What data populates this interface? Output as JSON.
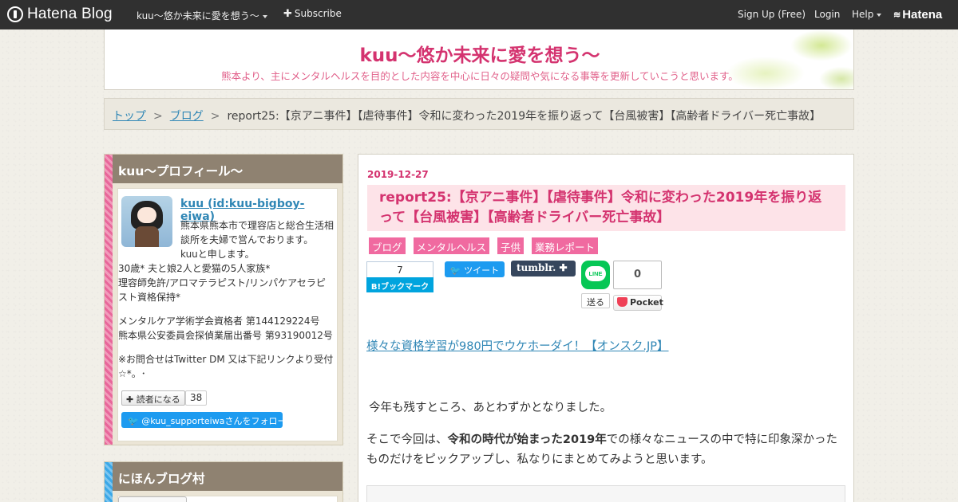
{
  "topbar": {
    "logo_text": "Hatena Blog",
    "blog_name": "kuu～悠か未来に愛を想う～",
    "subscribe_label": "Subscribe",
    "signup_label": "Sign Up (Free)",
    "login_label": "Login",
    "help_label": "Help",
    "hatena_label": "Hatena"
  },
  "header": {
    "title": "kuu～悠か未来に愛を想う～",
    "description": "熊本より、主にメンタルヘルスを目的とした内容を中心に日々の疑問や気になる事等を更新していこうと思います。"
  },
  "breadcrumb": {
    "items": [
      "トップ",
      "ブログ"
    ],
    "separator": ">",
    "current": "report25:【京アニ事件】【虐待事件】令和に変わった2019年を振り返って【台風被害】【高齢者ドライバー死亡事故】"
  },
  "sidebar": {
    "profile": {
      "title": "kuu～プロフィール～",
      "name": "kuu (id:kuu-bigboy-eiwa)",
      "bio_lines": [
        "熊本県熊本市で理容店と総合生活相談所を夫婦で営んでおります。",
        "kuuと申します。",
        "30歳* 夫と娘2人と愛猫の5人家族*",
        "理容師免許/アロマテラピスト/リンパケアセラピスト資格保持*",
        "メンタルケア学術学会資格者 第144129224号",
        "熊本県公安委員会探偵業届出番号 第93190012号",
        "※お問合せはTwitter DM 又は下記リンクより受付☆*。･"
      ],
      "reader_button": "読者になる",
      "reader_count": "38",
      "twitter_follow": "@kuu_supporteiwaさんをフォロー"
    },
    "village": {
      "title": "にほんブログ村"
    },
    "colors": {
      "profile_stripe": "#e8679a",
      "village_stripe": "#3ba8e8"
    }
  },
  "entry": {
    "date": "2019-12-27",
    "title": "report25:【京アニ事件】【虐待事件】令和に変わった2019年を振り返って【台風被害】【高齢者ドライバー死亡事故】",
    "categories": [
      "ブログ",
      "メンタルヘルス",
      "子供",
      "業務レポート"
    ],
    "share": {
      "hatebu_count": "7",
      "hatebu_label": "B!ブックマーク",
      "tweet_label": "ツイート",
      "tumblr_label": "tumblr.",
      "line_label": "LINE",
      "line_send": "送る",
      "pocket_count": "0",
      "pocket_label": "Pocket"
    },
    "promo_link": "様々な資格学習が980円でウケホーダイ！【オンスク.JP】",
    "para1": "今年も残すところ、あとわずかとなりました。",
    "para2_pre": "そこで今回は、",
    "para2_bold": "令和の時代が始まった2019年",
    "para2_post": "での様々なニュースの中で特に印象深かったものだけをピックアップし、私なりにまとめてみようと思います。"
  },
  "colors": {
    "accent_pink": "#d4336f",
    "category_pink": "#f06aa0",
    "link_blue": "#2f86b5",
    "module_title_bg": "#8f8271"
  }
}
